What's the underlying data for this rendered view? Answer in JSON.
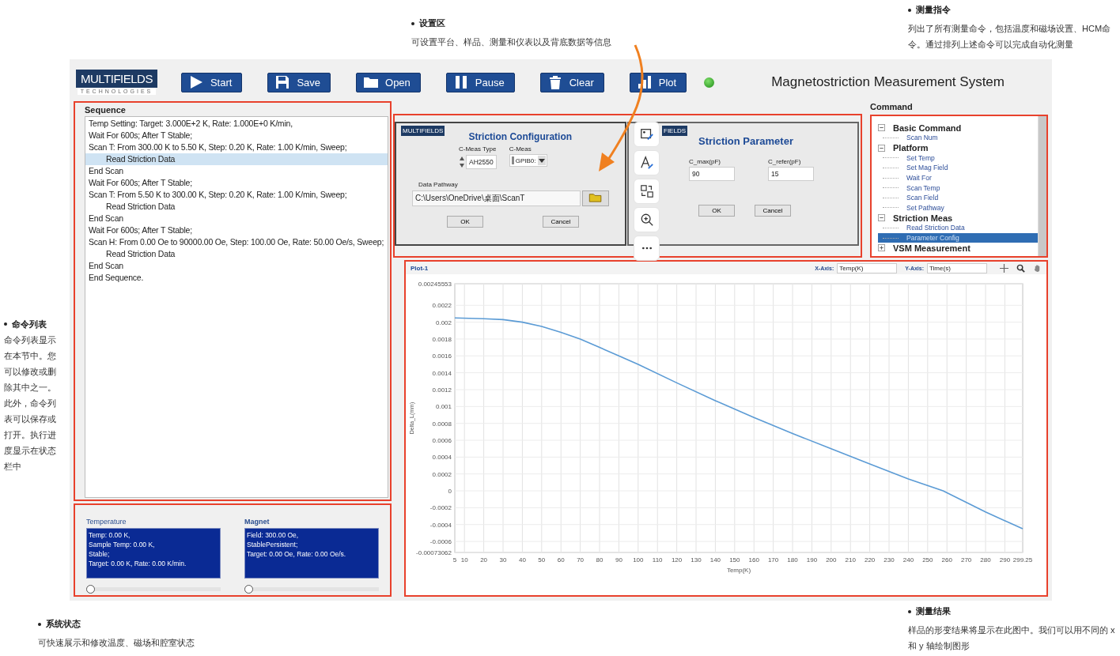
{
  "notes": [
    {
      "title": "设置区",
      "text": "可设置平台、样品、测量和仪表以及背底数据等信息"
    },
    {
      "title": "测量指令",
      "text": "列出了所有测量命令，包括温度和磁场设置、HCM命令。通过排列上述命令可以完成自动化测量"
    },
    {
      "title": "命令列表",
      "text": "命令列表显示在本节中。您可以修改或删除其中之一。此外，命令列表可以保存或打开。执行进度显示在状态栏中"
    },
    {
      "title": "系统状态",
      "text": "可快速展示和修改温度、磁场和腔室状态"
    },
    {
      "title": "测量结果",
      "text": "样品的形变结果将显示在此图中。我们可以用不同的 x 和 y 轴绘制图形"
    }
  ],
  "app": {
    "logo": {
      "name": "MULTIFIELDS",
      "tagline": "TECHNOLOGIES"
    },
    "toolbar": [
      {
        "label": "Start"
      },
      {
        "label": "Save"
      },
      {
        "label": "Open"
      },
      {
        "label": "Pause"
      },
      {
        "label": "Clear"
      },
      {
        "label": "Plot"
      }
    ],
    "status_light": {
      "on": true
    },
    "title": "Magnetostriction Measurement System",
    "sequence": {
      "title": "Sequence",
      "lines": [
        {
          "text": "Temp Setting: Target:  3.000E+2 K, Rate: 1.000E+0 K/min,",
          "selected": false
        },
        {
          "text": "Wait For 600s;  After T Stable;",
          "selected": false
        },
        {
          "text": "Scan T: From 300.00 K to 5.50 K, Step: 0.20 K, Rate: 1.00 K/min, Sweep;",
          "selected": false,
          "children": [
            {
              "text": "Read Striction Data",
              "selected": true
            }
          ]
        },
        {
          "text": "End Scan",
          "selected": false
        },
        {
          "text": "Wait For 600s;  After T Stable;",
          "selected": false
        },
        {
          "text": "Scan T: From 5.50 K to 300.00 K, Step: 0.20 K, Rate: 1.00 K/min, Sweep;",
          "selected": false,
          "children": [
            {
              "text": "Read Striction Data",
              "selected": false
            }
          ]
        },
        {
          "text": "End Scan",
          "selected": false
        },
        {
          "text": "Wait For 600s;  After T Stable;",
          "selected": false
        },
        {
          "text": "Scan H: From 0.00 Oe to 90000.00 Oe, Step: 100.00 Oe, Rate: 50.00 Oe/s, Sweep;",
          "selected": false,
          "children": [
            {
              "text": "Read Striction Data",
              "selected": false
            }
          ]
        },
        {
          "text": "End Scan",
          "selected": false
        },
        {
          "text": "End Sequence.",
          "selected": false
        }
      ]
    },
    "striction_config": {
      "logo": "MULTIFIELDS",
      "title": "Striction Configuration",
      "type_label": "C-Meas Type",
      "type_value": "AH2550",
      "meas_label": "C-Meas",
      "meas_value": "GPIB0:",
      "path_label": "Data Pathway",
      "path_value": "C:\\Users\\OneDrive\\桌面\\ScanT",
      "ok": "OK",
      "cancel": "Cancel"
    },
    "striction_parameter": {
      "logo": "FIELDS",
      "title": "Striction Parameter",
      "cmax_label": "C_max(pF)",
      "cmax_value": "90",
      "crefer_label": "C_refer(pF)",
      "crefer_value": "15",
      "ok": "OK",
      "cancel": "Cancel"
    },
    "command": {
      "title": "Command",
      "tree": [
        {
          "label": "Basic Command",
          "kind": "group",
          "expanded": true,
          "selected": false,
          "children": [
            {
              "label": "Scan Num",
              "kind": "command",
              "selected": false
            }
          ]
        },
        {
          "label": "Platform",
          "kind": "group",
          "expanded": true,
          "selected": false,
          "children": [
            {
              "label": "Set Temp",
              "kind": "command",
              "selected": false
            },
            {
              "label": "Set Mag Field",
              "kind": "command",
              "selected": false
            },
            {
              "label": "Wait For",
              "kind": "command",
              "selected": false
            },
            {
              "label": "Scan Temp",
              "kind": "command",
              "selected": false
            },
            {
              "label": "Scan Field",
              "kind": "command",
              "selected": false
            },
            {
              "label": "Set Pathway",
              "kind": "command",
              "selected": false
            }
          ]
        },
        {
          "label": "Striction Meas",
          "kind": "group",
          "expanded": true,
          "selected": false,
          "children": [
            {
              "label": "Read Striction Data",
              "kind": "command",
              "selected": false
            },
            {
              "label": "Parameter Config",
              "kind": "command",
              "selected": true
            }
          ]
        },
        {
          "label": "VSM Measurement",
          "kind": "group",
          "expanded": false,
          "selected": false
        }
      ]
    },
    "plot": {
      "title": "Plot-1",
      "x_axis_label": "X-Axis:",
      "x_axis_value": "Temp(K)",
      "y_axis_label": "Y-Axis:",
      "y_axis_value": "Time(s)",
      "chart_data": {
        "type": "line",
        "xlabel": "Temp(K)",
        "ylabel": "Delta_L(mm)",
        "x": [
          5,
          20,
          30,
          40,
          50,
          60,
          70,
          80,
          90,
          100,
          120,
          140,
          160,
          180,
          200,
          220,
          240,
          258,
          280,
          299.25
        ],
        "series": [
          {
            "color": "#5b9bd5",
            "values": [
              0.00205,
              0.00204,
              0.00203,
              0.002,
              0.00195,
              0.00188,
              0.0018,
              0.0017,
              0.0016,
              0.0015,
              0.00128,
              0.00107,
              0.00087,
              0.00068,
              0.0005,
              0.00032,
              0.00014,
              0,
              -0.00025,
              -0.00045
            ]
          }
        ],
        "grid": true,
        "xlim": [
          5,
          299.25
        ],
        "ylim": [
          -0.00073062,
          0.00245553
        ],
        "xticks": [
          5,
          10,
          20,
          30,
          40,
          50,
          60,
          70,
          80,
          90,
          100,
          110,
          120,
          130,
          140,
          150,
          160,
          170,
          180,
          190,
          200,
          210,
          220,
          230,
          240,
          250,
          260,
          270,
          280,
          290,
          299.25
        ],
        "yticks": [
          -0.00073062,
          -0.0006,
          -0.0004,
          -0.0002,
          0,
          0.0002,
          0.0004,
          0.0006,
          0.0008,
          0.001,
          0.0012,
          0.0014,
          0.0016,
          0.0018,
          0.002,
          0.0022,
          0.00245553
        ]
      }
    },
    "temperature": {
      "title": "Temperature",
      "lines": [
        "Temp: 0.00 K,",
        "Sample Temp: 0.00 K,",
        "Stable;",
        "Target: 0.00 K, Rate: 0.00 K/min."
      ],
      "level": 0
    },
    "magnet": {
      "title": "Magnet",
      "lines": [
        "Field: 300.00 Oe,",
        "StablePersistent;",
        "Target: 0.00 Oe, Rate: 0.00 Oe/s."
      ],
      "level": 0
    }
  }
}
